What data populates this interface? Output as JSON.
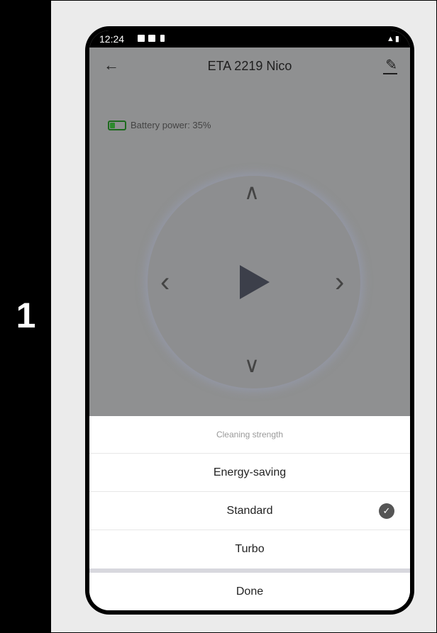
{
  "step": {
    "number": "1"
  },
  "statusbar": {
    "time": "12:24"
  },
  "header": {
    "back_icon": "←",
    "title": "ETA 2219 Nico",
    "edit_icon": "✎"
  },
  "battery": {
    "label": "Battery power: 35%",
    "level": 0.35,
    "color": "#2c8a2c"
  },
  "joystick": {
    "up": "∧",
    "down": "∨",
    "left": "‹",
    "right": "›"
  },
  "sheet": {
    "title": "Cleaning strength",
    "options": [
      {
        "label": "Energy-saving",
        "selected": false
      },
      {
        "label": "Standard",
        "selected": true
      },
      {
        "label": "Turbo",
        "selected": false
      }
    ],
    "check_icon": "✓",
    "done": "Done"
  }
}
